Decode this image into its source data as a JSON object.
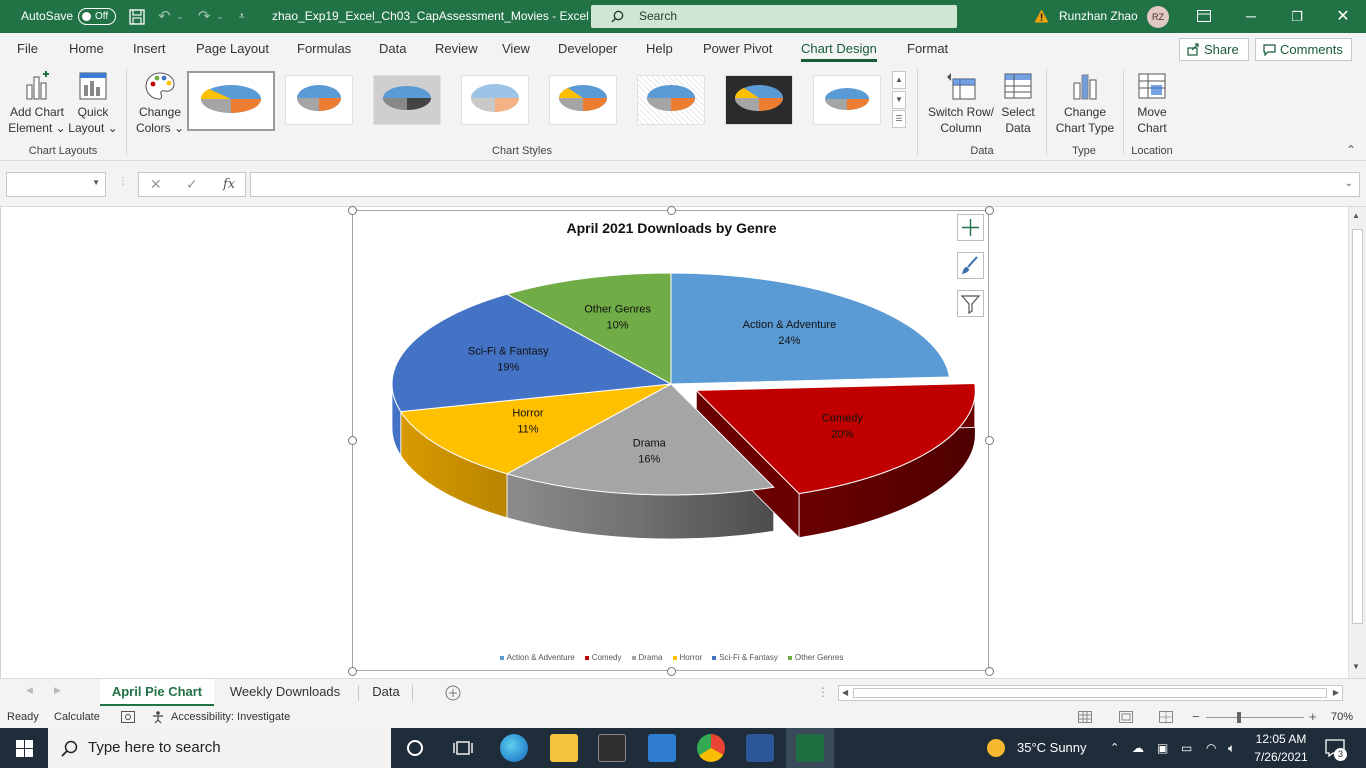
{
  "titlebar": {
    "autosave_label": "AutoSave",
    "autosave_state": "Off",
    "document_title": "zhao_Exp19_Excel_Ch03_CapAssessment_Movies  -  Excel",
    "search_placeholder": "Search",
    "user_name": "Runzhan Zhao",
    "user_initials": "RZ"
  },
  "menu": {
    "tabs": [
      "File",
      "Home",
      "Insert",
      "Page Layout",
      "Formulas",
      "Data",
      "Review",
      "View",
      "Developer",
      "Help",
      "Power Pivot",
      "Chart Design",
      "Format"
    ],
    "active": "Chart Design",
    "share_label": "Share",
    "comments_label": "Comments"
  },
  "ribbon": {
    "add_chart_element": [
      "Add Chart",
      "Element ⌄"
    ],
    "quick_layout": [
      "Quick",
      "Layout ⌄"
    ],
    "change_colors": [
      "Change",
      "Colors ⌄"
    ],
    "switch_row_column": [
      "Switch Row/",
      "Column"
    ],
    "select_data": [
      "Select",
      "Data"
    ],
    "change_chart_type": [
      "Change",
      "Chart Type"
    ],
    "move_chart": [
      "Move",
      "Chart"
    ],
    "groups": {
      "chart_layouts": "Chart Layouts",
      "chart_styles": "Chart Styles",
      "data": "Data",
      "type": "Type",
      "location": "Location"
    }
  },
  "formula_bar": {
    "name_box": "",
    "fx_label": "fx",
    "formula": ""
  },
  "chart_data": {
    "type": "pie",
    "title": "April 2021 Downloads by Genre",
    "categories": [
      "Action & Adventure",
      "Comedy",
      "Drama",
      "Horror",
      "Sci-Fi & Fantasy",
      "Other Genres"
    ],
    "values": [
      24,
      20,
      16,
      11,
      19,
      10
    ],
    "value_labels": [
      "24%",
      "20%",
      "16%",
      "11%",
      "19%",
      "10%"
    ],
    "colors": [
      "#5b9bd5",
      "#c00000",
      "#a5a5a5",
      "#ffc000",
      "#4472c4",
      "#70ad47"
    ],
    "exploded": "Comedy",
    "style": "3-D",
    "legend": "bottom"
  },
  "sheet_tabs": [
    "April Pie Chart",
    "Weekly Downloads",
    "Data"
  ],
  "active_sheet": "April Pie Chart",
  "status": {
    "ready": "Ready",
    "calculate": "Calculate",
    "accessibility": "Accessibility: Investigate",
    "zoom": "70%"
  },
  "taskbar": {
    "search_placeholder": "Type here to search",
    "weather": "35°C  Sunny",
    "time": "12:05 AM",
    "date": "7/26/2021",
    "notifications": "3"
  }
}
